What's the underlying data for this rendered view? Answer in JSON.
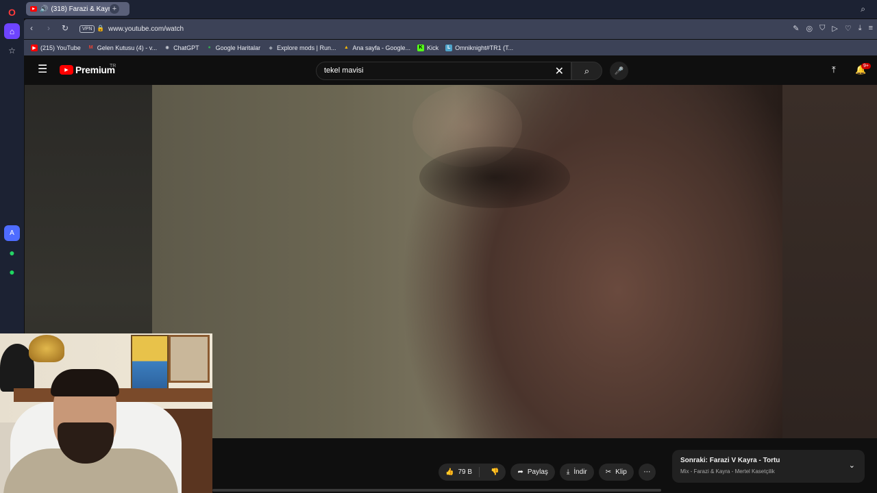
{
  "browser": {
    "active_tab": {
      "title": "(318) Farazi & Kayra -"
    },
    "url": "www.youtube.com/watch",
    "vpn_label": "VPN",
    "bookmarks": [
      {
        "label": "(215) YouTube",
        "icon": "youtube-icon",
        "color": "#ff0000"
      },
      {
        "label": "Gelen Kutusu (4) - v...",
        "icon": "gmail-icon",
        "color": "#ea4335"
      },
      {
        "label": "ChatGPT",
        "icon": "chatgpt-icon",
        "color": "#cfd2da"
      },
      {
        "label": "Google Haritalar",
        "icon": "maps-icon",
        "color": "#34a853"
      },
      {
        "label": "Explore mods | Run...",
        "icon": "runelite-icon",
        "color": "#9aa0ac"
      },
      {
        "label": "Ana sayfa - Google...",
        "icon": "drive-icon",
        "color": "#fbbc04"
      },
      {
        "label": "Kick",
        "icon": "kick-icon",
        "color": "#53fc18"
      },
      {
        "label": "Omniknight#TR1 (T...",
        "icon": "tracker-icon",
        "color": "#4fa3c9"
      }
    ]
  },
  "youtube": {
    "logo_text": "Premium",
    "region": "TR",
    "search_value": "tekel mavisi",
    "notification_count": "9+",
    "actions": {
      "like_count": "79 B",
      "share_label": "Paylaş",
      "download_label": "İndir",
      "clip_label": "Klip"
    },
    "up_next": {
      "title": "Sonraki: Farazi V Kayra - Tortu",
      "subtitle": "Mix - Farazi & Kayra - Mertel Kasetçilik"
    }
  },
  "colors": {
    "accent": "#ff0000",
    "opera_accent": "#6e44ff"
  }
}
